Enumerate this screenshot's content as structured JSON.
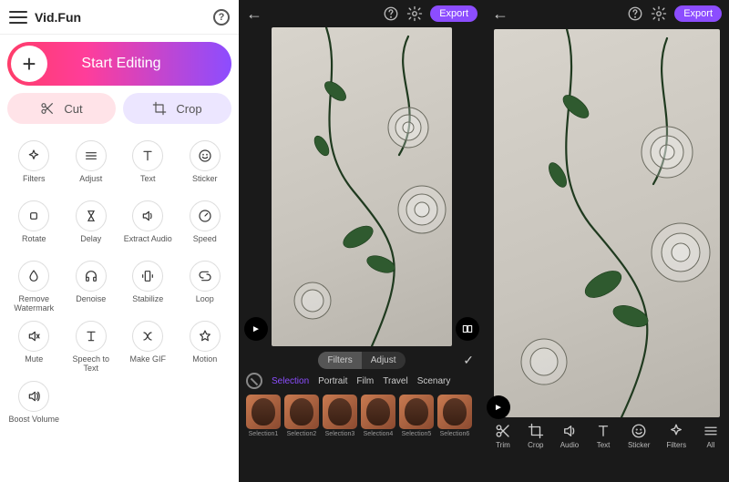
{
  "app": {
    "title": "Vid.Fun"
  },
  "start": {
    "label": "Start Editing"
  },
  "quick": {
    "cut": "Cut",
    "crop": "Crop"
  },
  "tools": [
    {
      "id": "filters",
      "label": "Filters"
    },
    {
      "id": "adjust",
      "label": "Adjust"
    },
    {
      "id": "text",
      "label": "Text"
    },
    {
      "id": "sticker",
      "label": "Sticker"
    },
    {
      "id": "rotate",
      "label": "Rotate"
    },
    {
      "id": "delay",
      "label": "Delay"
    },
    {
      "id": "extract-audio",
      "label": "Extract Audio"
    },
    {
      "id": "speed",
      "label": "Speed"
    },
    {
      "id": "remove-watermark",
      "label": "Remove Watermark"
    },
    {
      "id": "denoise",
      "label": "Denoise"
    },
    {
      "id": "stabilize",
      "label": "Stabilize"
    },
    {
      "id": "loop",
      "label": "Loop"
    },
    {
      "id": "mute",
      "label": "Mute"
    },
    {
      "id": "speech-to-text",
      "label": "Speech to Text"
    },
    {
      "id": "make-gif",
      "label": "Make GIF"
    },
    {
      "id": "motion",
      "label": "Motion"
    },
    {
      "id": "boost-volume",
      "label": "Boost Volume"
    }
  ],
  "editorHeader": {
    "export": "Export"
  },
  "filterPanel": {
    "tabs": {
      "filters": "Filters",
      "adjust": "Adjust"
    },
    "categories": [
      "Selection",
      "Portrait",
      "Film",
      "Travel",
      "Scenary"
    ],
    "thumbs": [
      "Selection1",
      "Selection2",
      "Selection3",
      "Selection4",
      "Selection5",
      "Selection6"
    ]
  },
  "bottomTools": [
    {
      "id": "trim",
      "label": "Trim"
    },
    {
      "id": "crop",
      "label": "Crop"
    },
    {
      "id": "audio",
      "label": "Audio"
    },
    {
      "id": "text",
      "label": "Text"
    },
    {
      "id": "sticker",
      "label": "Sticker"
    },
    {
      "id": "filters",
      "label": "Filters"
    },
    {
      "id": "all",
      "label": "All"
    }
  ]
}
